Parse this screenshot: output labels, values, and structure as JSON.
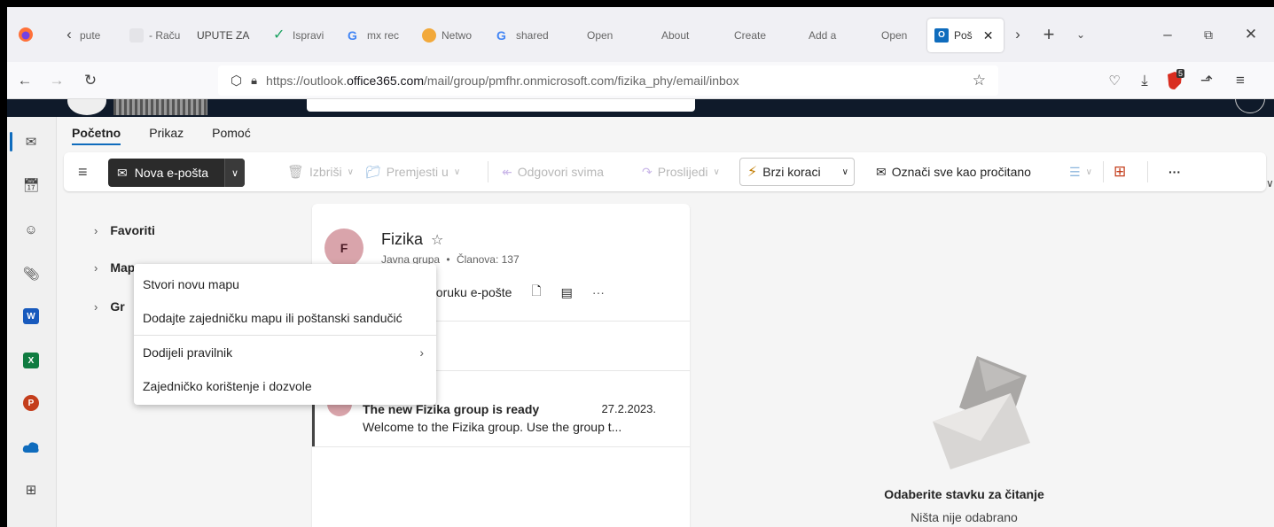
{
  "browser": {
    "tabs": [
      {
        "label": "pute",
        "icon": "firefox-tab-icon"
      },
      {
        "label": "- Raču",
        "icon": "page-icon"
      },
      {
        "label": "UPUTE ZA",
        "icon": "page-icon"
      },
      {
        "label": "Ispravi",
        "icon": "checkmark-icon"
      },
      {
        "label": "mx rec",
        "icon": "google-icon"
      },
      {
        "label": "Netwo",
        "icon": "network-icon"
      },
      {
        "label": "shared",
        "icon": "google-icon"
      },
      {
        "label": "Open",
        "icon": "microsoft-icon"
      },
      {
        "label": "About",
        "icon": "microsoft-icon"
      },
      {
        "label": "Create",
        "icon": "microsoft-icon"
      },
      {
        "label": "Add a",
        "icon": "microsoft-icon"
      },
      {
        "label": "Open",
        "icon": "microsoft-icon"
      }
    ],
    "active_tab": {
      "label": "Poš",
      "icon": "outlook-icon"
    },
    "url_prefix": "https://outlook.",
    "url_domain": "office365.com",
    "url_path": "/mail/group/pmfhr.onmicrosoft.com/fizika_phy/email/inbox",
    "downloads_badge": "5"
  },
  "ribbon": {
    "tabs": [
      "Početno",
      "Prikaz",
      "Pomoć"
    ],
    "new_mail": "Nova e-pošta",
    "delete": "Izbriši",
    "move": "Premjesti u",
    "reply_all": "Odgovori svima",
    "forward": "Proslijedi",
    "quick_steps": "Brzi koraci",
    "mark_read": "Označi sve kao pročitano",
    "more": "···"
  },
  "folders": {
    "favorites": "Favoriti",
    "folders": "Mape",
    "groups": "Gr"
  },
  "group": {
    "avatar": "F",
    "name": "Fizika",
    "type": "Javna grupa",
    "members": "Članova: 137",
    "send_email": "šalji poruku e-pošte",
    "more": "···"
  },
  "message": {
    "subject": "The new Fizika group is ready",
    "date": "27.2.2023.",
    "preview": "Welcome to the Fizika group. Use the group t..."
  },
  "reading_pane": {
    "title": "Odaberite stavku za čitanje",
    "subtitle": "Ništa nije odabrano"
  },
  "context_menu": {
    "items": [
      "Stvori novu mapu",
      "Dodajte zajedničku mapu ili poštanski sandučić",
      "Dodijeli pravilnik",
      "Zajedničko korištenje i dozvole"
    ]
  },
  "colors": {
    "accent": "#0f6cbd",
    "group_avatar": "#d9a4ab",
    "new_mail_button": "#2b2b2b"
  }
}
